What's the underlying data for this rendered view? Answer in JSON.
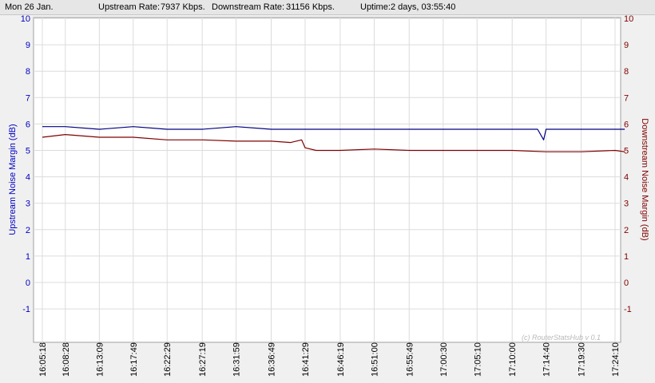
{
  "status": {
    "date": "Mon 26 Jan.",
    "upstream_rate_label": "Upstream Rate:",
    "upstream_rate_value": "7937 Kbps.",
    "downstream_rate_label": "Downstream Rate:",
    "downstream_rate_value": "31156 Kbps.",
    "uptime_label": "Uptime:",
    "uptime_value": "2 days, 03:55:40"
  },
  "colors": {
    "upstream": "#000080",
    "downstream": "#800000",
    "grid": "#dcdcdc",
    "left_axis": "#0000c0",
    "right_axis": "#800000"
  },
  "chart_data": {
    "type": "line",
    "ylabel_left": "Upstream Noise Margin (dB)",
    "ylabel_right": "Downstream Noise Margin (dB)",
    "ylim": [
      -2.2,
      10
    ],
    "yticks": [
      -1,
      0,
      1,
      2,
      3,
      4,
      5,
      6,
      7,
      8,
      9,
      10
    ],
    "x_tick_labels": [
      "16:05:18",
      "16:08:28",
      "16:13:09",
      "16:17:49",
      "16:22:29",
      "16:27:19",
      "16:31:59",
      "16:36:49",
      "16:41:29",
      "16:46:19",
      "16:51:00",
      "16:55:49",
      "17:00:30",
      "17:05:10",
      "17:10:00",
      "17:14:40",
      "17:19:30",
      "17:24:10"
    ],
    "grid": true,
    "watermark": "(c) RouterStatsHub v 0.1",
    "series": [
      {
        "key": "upstream",
        "x": [
          "16:05:18",
          "16:08:28",
          "16:13:09",
          "16:17:49",
          "16:22:29",
          "16:27:19",
          "16:31:59",
          "16:36:49",
          "16:40:30",
          "16:41:29",
          "16:46:19",
          "16:51:00",
          "16:55:49",
          "17:00:30",
          "17:05:10",
          "17:10:00",
          "17:12:30",
          "17:13:30",
          "17:14:20",
          "17:14:40",
          "17:19:30",
          "17:24:10",
          "17:25:30"
        ],
        "values": [
          5.9,
          5.9,
          5.8,
          5.9,
          5.8,
          5.8,
          5.9,
          5.8,
          5.8,
          5.8,
          5.8,
          5.8,
          5.8,
          5.8,
          5.8,
          5.8,
          5.8,
          5.8,
          5.4,
          5.8,
          5.8,
          5.8,
          5.8
        ]
      },
      {
        "key": "downstream",
        "x": [
          "16:05:18",
          "16:08:28",
          "16:13:09",
          "16:17:49",
          "16:22:29",
          "16:27:19",
          "16:31:59",
          "16:36:49",
          "16:39:30",
          "16:41:00",
          "16:41:29",
          "16:43:00",
          "16:46:19",
          "16:51:00",
          "16:55:49",
          "17:00:30",
          "17:05:10",
          "17:10:00",
          "17:14:40",
          "17:19:30",
          "17:24:10",
          "17:25:30"
        ],
        "values": [
          5.5,
          5.6,
          5.5,
          5.5,
          5.4,
          5.4,
          5.35,
          5.35,
          5.3,
          5.4,
          5.1,
          5.0,
          5.0,
          5.05,
          5.0,
          5.0,
          5.0,
          5.0,
          4.95,
          4.95,
          5.0,
          4.95
        ]
      }
    ]
  }
}
